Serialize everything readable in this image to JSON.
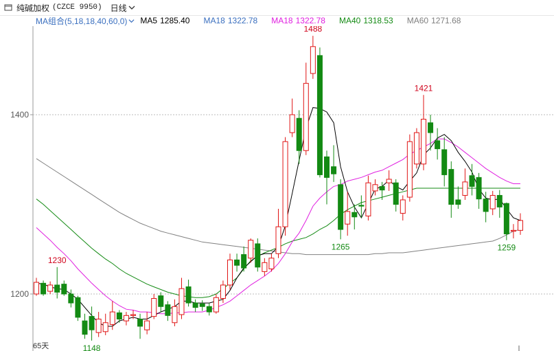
{
  "header": {
    "instrument": "纯碱加权",
    "code": "(CZCE 9950)",
    "period": "日线",
    "doc_icon": "document-icon",
    "period_icon": "chevron-down-icon"
  },
  "legend": {
    "group": "MA组合(5,18,18,40,60,0)",
    "items": [
      {
        "label": "MA5",
        "value": "1285.40",
        "color": "#000000"
      },
      {
        "label": "MA18",
        "value": "1322.78",
        "color": "#3a6fbf"
      },
      {
        "label": "MA18",
        "value": "1322.78",
        "color": "#e020e0"
      },
      {
        "label": "MA40",
        "value": "1318.53",
        "color": "#138a13"
      },
      {
        "label": "MA60",
        "value": "1271.68",
        "color": "#808080"
      }
    ]
  },
  "footer": {
    "days": "65天"
  },
  "colors": {
    "up": "#e01414",
    "down": "#138a13",
    "grid": "#bbbbbb"
  },
  "chart_data": {
    "type": "candlestick",
    "ylim": [
      1140,
      1500
    ],
    "y_ticks": [
      1200,
      1400
    ],
    "annotations": {
      "high": [
        "1488",
        "1421",
        "1230"
      ],
      "low": [
        "1148",
        "1265",
        "1259"
      ]
    },
    "candles": [
      [
        1200,
        1213,
        1218,
        1198
      ],
      [
        1212,
        1200,
        1215,
        1198
      ],
      [
        1203,
        1210,
        1214,
        1200
      ],
      [
        1210,
        1202,
        1230,
        1195
      ],
      [
        1211,
        1200,
        1215,
        1198
      ],
      [
        1200,
        1190,
        1205,
        1185
      ],
      [
        1196,
        1174,
        1198,
        1170
      ],
      [
        1170,
        1155,
        1178,
        1150
      ],
      [
        1175,
        1160,
        1186,
        1148
      ],
      [
        1157,
        1172,
        1180,
        1152
      ],
      [
        1158,
        1168,
        1178,
        1154
      ],
      [
        1166,
        1180,
        1192,
        1160
      ],
      [
        1179,
        1172,
        1182,
        1168
      ],
      [
        1170,
        1176,
        1180,
        1165
      ],
      [
        1176,
        1177,
        1182,
        1172
      ],
      [
        1172,
        1164,
        1178,
        1150
      ],
      [
        1160,
        1170,
        1180,
        1155
      ],
      [
        1175,
        1195,
        1200,
        1172
      ],
      [
        1198,
        1186,
        1202,
        1180
      ],
      [
        1188,
        1176,
        1192,
        1170
      ],
      [
        1168,
        1186,
        1194,
        1164
      ],
      [
        1177,
        1206,
        1218,
        1172
      ],
      [
        1208,
        1190,
        1216,
        1186
      ],
      [
        1190,
        1185,
        1194,
        1180
      ],
      [
        1189,
        1186,
        1193,
        1181
      ],
      [
        1186,
        1180,
        1190,
        1176
      ],
      [
        1180,
        1196,
        1200,
        1178
      ],
      [
        1195,
        1210,
        1215,
        1190
      ],
      [
        1210,
        1238,
        1245,
        1205
      ],
      [
        1238,
        1232,
        1245,
        1225
      ],
      [
        1244,
        1229,
        1253,
        1225
      ],
      [
        1240,
        1260,
        1262,
        1235
      ],
      [
        1256,
        1230,
        1262,
        1225
      ],
      [
        1225,
        1235,
        1240,
        1220
      ],
      [
        1228,
        1240,
        1245,
        1225
      ],
      [
        1245,
        1275,
        1295,
        1240
      ],
      [
        1275,
        1370,
        1375,
        1265
      ],
      [
        1380,
        1400,
        1418,
        1375
      ],
      [
        1396,
        1360,
        1405,
        1345
      ],
      [
        1360,
        1435,
        1458,
        1355
      ],
      [
        1446,
        1476,
        1488,
        1440
      ],
      [
        1466,
        1333,
        1475,
        1330
      ],
      [
        1353,
        1330,
        1360,
        1300
      ],
      [
        1342,
        1334,
        1366,
        1325
      ],
      [
        1322,
        1272,
        1328,
        1261
      ],
      [
        1278,
        1292,
        1314,
        1265
      ],
      [
        1291,
        1286,
        1300,
        1272
      ],
      [
        1299,
        1298,
        1310,
        1285
      ],
      [
        1287,
        1324,
        1332,
        1282
      ],
      [
        1315,
        1322,
        1328,
        1310
      ],
      [
        1320,
        1316,
        1325,
        1305
      ],
      [
        1324,
        1328,
        1338,
        1315
      ],
      [
        1324,
        1300,
        1328,
        1292
      ],
      [
        1290,
        1305,
        1310,
        1282
      ],
      [
        1308,
        1370,
        1378,
        1303
      ],
      [
        1345,
        1380,
        1385,
        1340
      ],
      [
        1345,
        1395,
        1422,
        1338
      ],
      [
        1391,
        1380,
        1400,
        1360
      ],
      [
        1371,
        1362,
        1385,
        1350
      ],
      [
        1361,
        1333,
        1375,
        1320
      ],
      [
        1339,
        1300,
        1348,
        1285
      ],
      [
        1305,
        1300,
        1320,
        1295
      ],
      [
        1310,
        1325,
        1340,
        1305
      ],
      [
        1332,
        1320,
        1345,
        1310
      ],
      [
        1330,
        1306,
        1335,
        1295
      ],
      [
        1306,
        1292,
        1314,
        1280
      ],
      [
        1295,
        1310,
        1315,
        1288
      ],
      [
        1310,
        1297,
        1316,
        1285
      ],
      [
        1301,
        1267,
        1302,
        1260
      ],
      [
        1270,
        1271,
        1278,
        1262
      ],
      [
        1271,
        1282,
        1290,
        1266
      ]
    ],
    "ma_lines": {
      "MA5": [
        1212,
        1211,
        1208,
        1206,
        1205,
        1200,
        1194,
        1185,
        1176,
        1168,
        1164,
        1164,
        1170,
        1172,
        1174,
        1172,
        1172,
        1176,
        1180,
        1183,
        1186,
        1192,
        1192,
        1190,
        1190,
        1190,
        1192,
        1194,
        1204,
        1218,
        1229,
        1236,
        1243,
        1245,
        1245,
        1253,
        1276,
        1312,
        1349,
        1385,
        1408,
        1407,
        1403,
        1391,
        1342,
        1314,
        1297,
        1285,
        1301,
        1317,
        1320,
        1327,
        1320,
        1316,
        1326,
        1335,
        1355,
        1363,
        1374,
        1378,
        1371,
        1358,
        1348,
        1336,
        1317,
        1307,
        1305,
        1306,
        1295,
        1285,
        1282
      ],
      "MA18": [
        1274,
        1267,
        1260,
        1252,
        1245,
        1237,
        1228,
        1220,
        1212,
        1205,
        1198,
        1192,
        1187,
        1183,
        1182,
        1180,
        1180,
        1179,
        1178,
        1178,
        1179,
        1179,
        1180,
        1180,
        1180,
        1182,
        1185,
        1188,
        1192,
        1198,
        1204,
        1210,
        1215,
        1220,
        1226,
        1234,
        1245,
        1258,
        1268,
        1282,
        1298,
        1307,
        1314,
        1320,
        1322,
        1326,
        1328,
        1330,
        1333,
        1336,
        1338,
        1342,
        1346,
        1350,
        1356,
        1360,
        1364,
        1368,
        1373,
        1373,
        1369,
        1364,
        1358,
        1352,
        1346,
        1340,
        1335,
        1330,
        1326,
        1323,
        1323
      ],
      "MA40": [
        1306,
        1300,
        1293,
        1286,
        1279,
        1272,
        1265,
        1258,
        1251,
        1245,
        1239,
        1234,
        1228,
        1223,
        1219,
        1215,
        1211,
        1208,
        1205,
        1202,
        1200,
        1198,
        1197,
        1196,
        1196,
        1197,
        1200,
        1206,
        1212,
        1218,
        1228,
        1237,
        1242,
        1246,
        1249,
        1252,
        1256,
        1259,
        1261,
        1263,
        1267,
        1272,
        1276,
        1282,
        1289,
        1294,
        1298,
        1302,
        1304,
        1306,
        1308,
        1310,
        1312,
        1314,
        1316,
        1318,
        1318,
        1318,
        1318,
        1318,
        1318,
        1318,
        1318,
        1318,
        1318,
        1318,
        1318,
        1318,
        1318,
        1318,
        1318
      ],
      "MA60": [
        1351,
        1346,
        1341,
        1336,
        1331,
        1326,
        1321,
        1316,
        1311,
        1306,
        1301,
        1296,
        1291,
        1287,
        1283,
        1279,
        1276,
        1273,
        1270,
        1268,
        1266,
        1264,
        1262,
        1260,
        1258,
        1257,
        1256,
        1255,
        1254,
        1253,
        1252,
        1251,
        1250,
        1249,
        1248,
        1247,
        1246,
        1245,
        1245,
        1244,
        1244,
        1244,
        1244,
        1244,
        1244,
        1244,
        1244,
        1244,
        1244,
        1245,
        1245,
        1246,
        1246,
        1246,
        1247,
        1248,
        1249,
        1250,
        1251,
        1252,
        1253,
        1254,
        1255,
        1256,
        1257,
        1258,
        1259,
        1262,
        1266,
        1270,
        1272
      ]
    }
  }
}
